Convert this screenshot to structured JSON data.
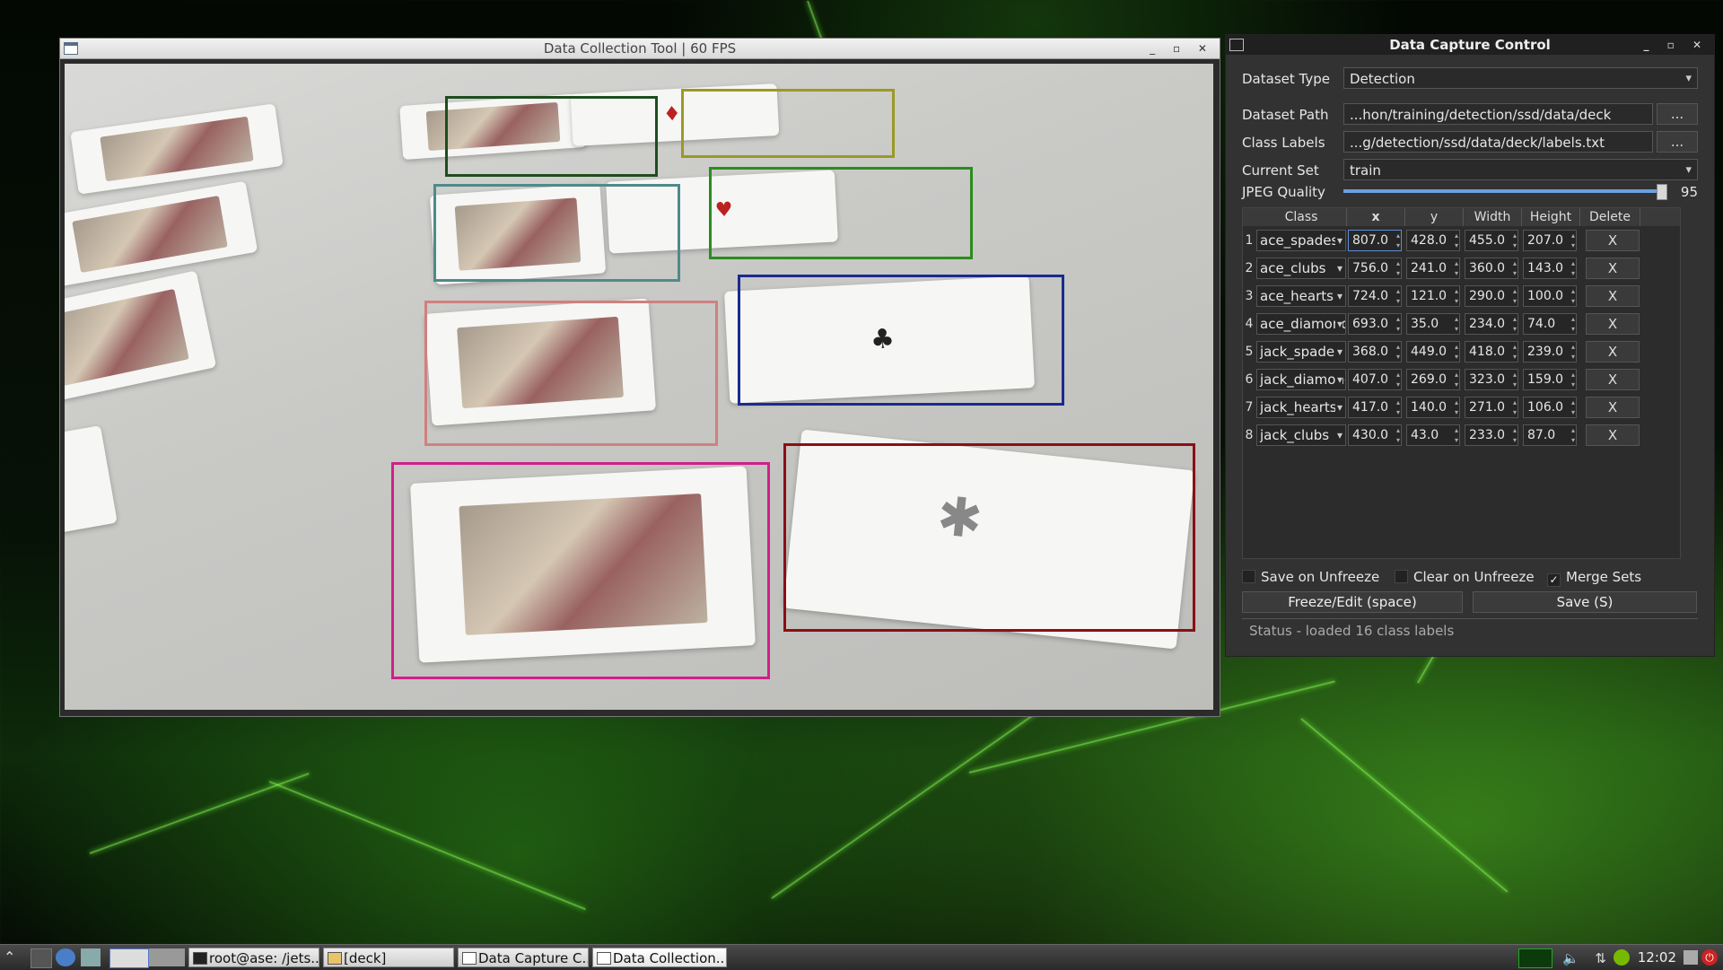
{
  "desktop": {
    "wallpaper": "nvidia-green-neural"
  },
  "camera_window": {
    "title": "Data Collection Tool | 60 FPS",
    "boxes": [
      {
        "label": "dark-green box",
        "color": "#1e4d1e"
      },
      {
        "label": "olive box",
        "color": "#9a9a25"
      },
      {
        "label": "teal box",
        "color": "#4f8a8a"
      },
      {
        "label": "green box",
        "color": "#2a8c1e"
      },
      {
        "label": "salmon box",
        "color": "#d08080"
      },
      {
        "label": "blue box",
        "color": "#1a2a90"
      },
      {
        "label": "magenta box",
        "color": "#d0208a"
      },
      {
        "label": "dark-red box",
        "color": "#8a0f14"
      }
    ]
  },
  "control": {
    "title": "Data Capture Control",
    "dataset_type": {
      "label": "Dataset Type",
      "value": "Detection"
    },
    "dataset_path": {
      "label": "Dataset Path",
      "value": "...hon/training/detection/ssd/data/deck",
      "button": "..."
    },
    "class_labels": {
      "label": "Class Labels",
      "value": "...g/detection/ssd/data/deck/labels.txt",
      "button": "..."
    },
    "current_set": {
      "label": "Current Set",
      "value": "train"
    },
    "jpeg_quality": {
      "label": "JPEG Quality",
      "value": "95"
    },
    "table": {
      "headers": [
        "Class",
        "x",
        "y",
        "Width",
        "Height",
        "Delete"
      ],
      "rows": [
        {
          "n": "1",
          "cls": "ace_spades",
          "x": "807.0",
          "y": "428.0",
          "w": "455.0",
          "h": "207.0",
          "del": "X"
        },
        {
          "n": "2",
          "cls": "ace_clubs",
          "x": "756.0",
          "y": "241.0",
          "w": "360.0",
          "h": "143.0",
          "del": "X"
        },
        {
          "n": "3",
          "cls": "ace_hearts",
          "x": "724.0",
          "y": "121.0",
          "w": "290.0",
          "h": "100.0",
          "del": "X"
        },
        {
          "n": "4",
          "cls": "ace_diamonds",
          "x": "693.0",
          "y": "35.0",
          "w": "234.0",
          "h": "74.0",
          "del": "X"
        },
        {
          "n": "5",
          "cls": "jack_spades",
          "x": "368.0",
          "y": "449.0",
          "w": "418.0",
          "h": "239.0",
          "del": "X"
        },
        {
          "n": "6",
          "cls": "jack_diamonds",
          "x": "407.0",
          "y": "269.0",
          "w": "323.0",
          "h": "159.0",
          "del": "X"
        },
        {
          "n": "7",
          "cls": "jack_hearts",
          "x": "417.0",
          "y": "140.0",
          "w": "271.0",
          "h": "106.0",
          "del": "X"
        },
        {
          "n": "8",
          "cls": "jack_clubs",
          "x": "430.0",
          "y": "43.0",
          "w": "233.0",
          "h": "87.0",
          "del": "X"
        }
      ]
    },
    "save_on_unfreeze": {
      "label": "Save on Unfreeze",
      "checked": false
    },
    "clear_on_unfreeze": {
      "label": "Clear on Unfreeze",
      "checked": false
    },
    "merge_sets": {
      "label": "Merge Sets",
      "checked": true,
      "mark": "✓"
    },
    "freeze_button": "Freeze/Edit (space)",
    "save_button": "Save (S)",
    "status": "Status - loaded 16 class labels"
  },
  "taskbar": {
    "tasks": [
      "root@ase: /jets...",
      "[deck]",
      "Data Capture C...",
      "Data Collection..."
    ],
    "clock": "12:02"
  }
}
